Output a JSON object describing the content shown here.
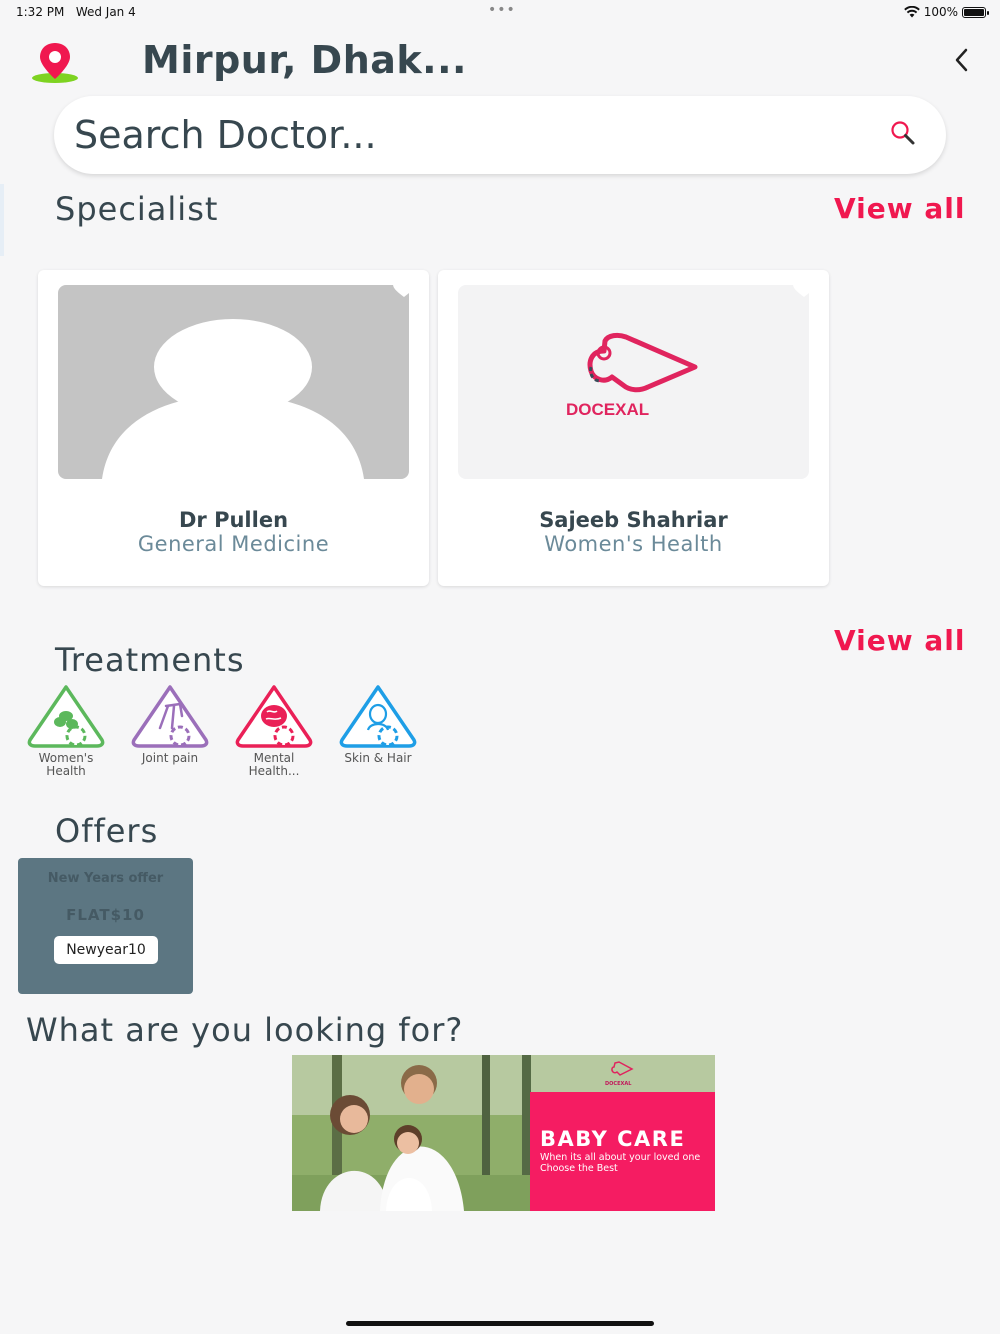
{
  "status_bar": {
    "time": "1:32 PM",
    "date": "Wed Jan 4",
    "battery": "100%",
    "battery_level": 1.0
  },
  "header": {
    "location": "Mirpur, Dhak...",
    "pin_icon": "map-pin-icon",
    "back_icon": "chevron-left-icon"
  },
  "search": {
    "placeholder": "Search Doctor...",
    "icon": "search-icon"
  },
  "specialist": {
    "title": "Specialist",
    "view_all": "View all",
    "doctors": [
      {
        "name": "Dr Pullen",
        "specialty": "General Medicine",
        "photo": "avatar-placeholder"
      },
      {
        "name": "Sajeeb Shahriar",
        "specialty": "Women's Health",
        "photo": "docexal-logo",
        "logo_text": "DOCEXAL"
      }
    ]
  },
  "treatments": {
    "title": "Treatments",
    "view_all": "View all",
    "items": [
      {
        "label_line1": "Women's",
        "label_line2": "Health",
        "color": "#5cb85c",
        "icon": "pills-icon"
      },
      {
        "label_line1": "Joint pain",
        "label_line2": "",
        "color": "#9b6fba",
        "icon": "joint-icon"
      },
      {
        "label_line1": "Mental",
        "label_line2": "Health...",
        "color": "#ea2057",
        "icon": "brain-icon"
      },
      {
        "label_line1": "Skin & Hair",
        "label_line2": "",
        "color": "#1e9ee6",
        "icon": "face-icon"
      }
    ]
  },
  "offers": {
    "title": "Offers",
    "items": [
      {
        "title": "New Years offer",
        "amount": "FLAT$10",
        "code": "Newyear10"
      }
    ]
  },
  "looking_for": {
    "title": "What are you looking for?",
    "banner": {
      "logo_text": "DOCEXAL",
      "title": "BABY CARE",
      "text": "When its all about your loved one Choose the Best"
    }
  },
  "colors": {
    "accent": "#f0184f",
    "text": "#37474f",
    "muted": "#6b8a99",
    "offer_bg": "#5c7682",
    "banner_pink": "#f51c62"
  }
}
